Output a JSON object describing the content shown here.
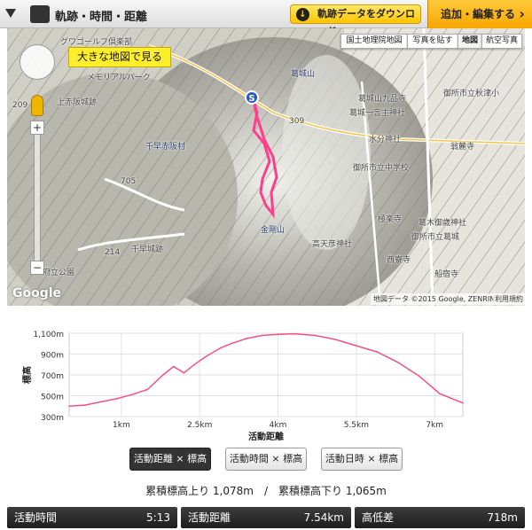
{
  "header": {
    "title": "軌跡・時間・距離",
    "download_label": "軌跡データをダウンロード",
    "edit_label": "追加・編集する"
  },
  "map": {
    "types": [
      "国土地理院地図",
      "写真を貼す",
      "地図",
      "航空写真"
    ],
    "active_type": "地図",
    "big_map_label": "大きな地図で見る",
    "start_marker": "S",
    "attribution": "地図データ ©2015 Google, ZENRIN",
    "terms": "利用規約",
    "google": "Google",
    "labels": {
      "golf": "グワゴールフ倶楽部",
      "kamiakasaka": "上赤阪城跡",
      "chihaya_akasaka": "千早赤阪村",
      "chihaya_castle": "千早城跡",
      "park": "府立公園",
      "katsuragi": "葛城山",
      "katsuragi_kuhin": "葛城山九品寺",
      "katsuragi_ichi": "葛城一言主神社",
      "mizukoshi": "水分神社",
      "school": "御所市立中学校",
      "kongo": "金剛山",
      "takamahiko": "高天彦神社",
      "gose_akihata": "御所市立秋津小",
      "goryou": "翁麓寺",
      "gokurakuji": "極楽寺",
      "kashihara": "西寮寺",
      "funabashi": "船宿寺",
      "gose_katsuragi": "御所市立葛城",
      "yoneyama": "葛木御歳神社",
      "road_309": "309",
      "road_705": "705",
      "road_214": "214",
      "road_209": "209",
      "memorial": "メモリアルパーク"
    }
  },
  "chart_data": {
    "type": "area",
    "xlabel": "活動距離",
    "ylabel": "標高",
    "x_ticks": [
      "1km",
      "2.5km",
      "4km",
      "5.5km",
      "7km"
    ],
    "y_ticks": [
      "1,100m",
      "900m",
      "700m",
      "500m",
      "300m"
    ],
    "ylim": [
      300,
      1100
    ],
    "xlim": [
      0,
      7.54
    ],
    "x": [
      0,
      0.3,
      0.6,
      0.9,
      1.2,
      1.5,
      1.8,
      2.0,
      2.2,
      2.4,
      2.6,
      2.9,
      3.1,
      3.4,
      3.7,
      4.0,
      4.3,
      4.7,
      5.1,
      5.5,
      5.9,
      6.3,
      6.7,
      7.1,
      7.54
    ],
    "y": [
      400,
      410,
      440,
      470,
      510,
      560,
      700,
      780,
      720,
      800,
      870,
      960,
      1000,
      1050,
      1080,
      1090,
      1095,
      1080,
      1040,
      980,
      920,
      820,
      690,
      520,
      430
    ],
    "color": "#f0508c"
  },
  "chart_tabs": [
    "活動距離 × 標高",
    "活動時間 × 標高",
    "活動日時 × 標高"
  ],
  "climb_text": "累積標高上り 1,078m　/　累積標高下り 1,065m",
  "stats": [
    {
      "label": "活動時間",
      "value": "5:13"
    },
    {
      "label": "活動距離",
      "value": "7.54km"
    },
    {
      "label": "高低差",
      "value": "718m"
    }
  ]
}
